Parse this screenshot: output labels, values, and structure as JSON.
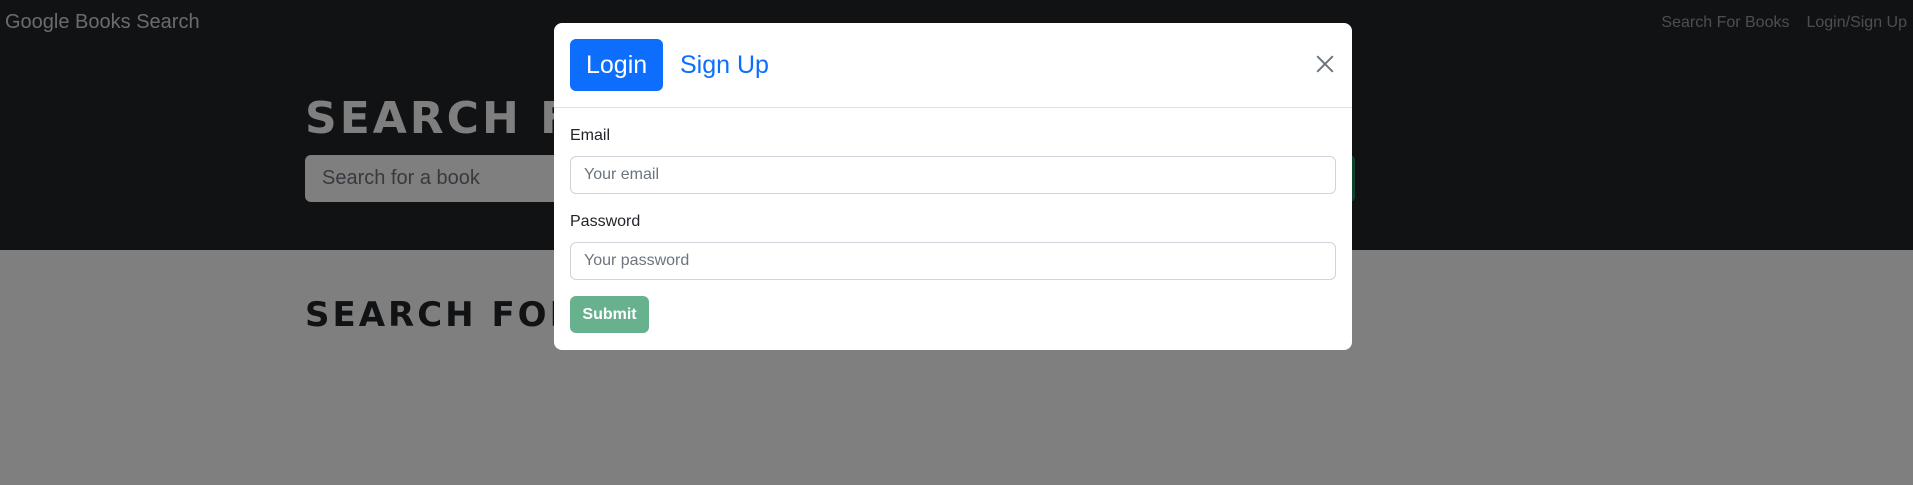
{
  "navbar": {
    "brand": "Google Books Search",
    "links": [
      "Search For Books",
      "Login/Sign Up"
    ]
  },
  "hero": {
    "title": "SEARCH FOR BOOKS!",
    "search_placeholder": "Search for a book"
  },
  "content": {
    "title": "SEARCH FOR A BOOK TO BEGIN"
  },
  "modal": {
    "tabs": [
      "Login",
      "Sign Up"
    ],
    "active_tab": "Login",
    "email_label": "Email",
    "email_placeholder": "Your email",
    "password_label": "Password",
    "password_placeholder": "Your password",
    "submit_label": "Submit"
  },
  "colors": {
    "navbar_bg": "#212529",
    "primary": "#0d6efd",
    "success_disabled": "#67b18e",
    "backdrop": "rgba(0,0,0,0.5)"
  },
  "icons": {
    "close": "close-icon"
  }
}
